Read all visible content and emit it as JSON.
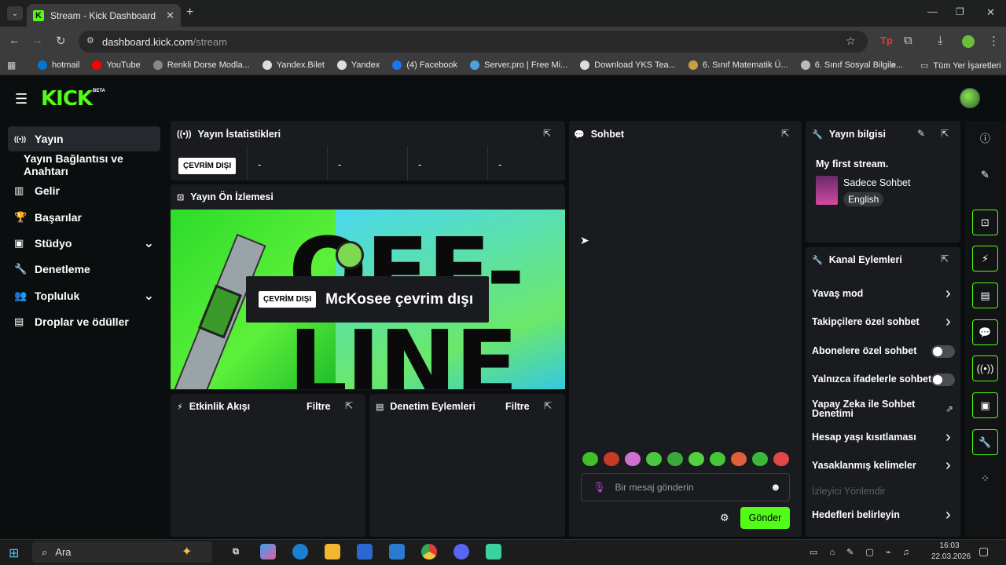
{
  "browser": {
    "tab_title": "Stream - Kick Dashboard",
    "url_host": "dashboard.kick.com",
    "url_path": "/stream",
    "bookmarks": [
      {
        "label": "hotmail",
        "color": "#0078d4"
      },
      {
        "label": "YouTube",
        "color": "#ff0000"
      },
      {
        "label": "Renkli Dorse Modla...",
        "color": "#888888"
      },
      {
        "label": "Yandex.Bilet",
        "color": "#dddddd"
      },
      {
        "label": "Yandex",
        "color": "#dddddd"
      },
      {
        "label": "(4) Facebook",
        "color": "#1877f2"
      },
      {
        "label": "Server.pro | Free Mi...",
        "color": "#4aa3df"
      },
      {
        "label": "Download YKS Tea...",
        "color": "#dddddd"
      },
      {
        "label": "6. Sınıf Matematik Ü...",
        "color": "#c8a040"
      },
      {
        "label": "6. Sınıf Sosyal Bilgile...",
        "color": "#bbbbbb"
      }
    ],
    "bookmarks_all": "Tüm Yer İşaretleri"
  },
  "header": {
    "logo": "KICK",
    "beta": "BETA"
  },
  "sidebar": {
    "items": [
      {
        "label": "Yayın",
        "icon": "broadcast-icon",
        "active": true
      },
      {
        "label": "Yayın Bağlantısı ve Anahtarı",
        "icon": ""
      },
      {
        "label": "Gelir",
        "icon": "chart-icon"
      },
      {
        "label": "Başarılar",
        "icon": "trophy-icon"
      },
      {
        "label": "Stüdyo",
        "icon": "studio-icon"
      },
      {
        "label": "Denetleme",
        "icon": "wrench-icon"
      },
      {
        "label": "Topluluk",
        "icon": "people-icon"
      },
      {
        "label": "Droplar ve ödüller",
        "icon": "gift-icon"
      }
    ]
  },
  "stats": {
    "title": "Yayın İstatistikleri",
    "status": "ÇEVRİM DIŞI",
    "values": [
      "-",
      "-",
      "-",
      "-"
    ]
  },
  "preview": {
    "title": "Yayın Ön İzlemesi",
    "status": "ÇEVRİM DIŞI",
    "message": "McKosee çevrim dışı",
    "art_text": "OFF-LINE"
  },
  "activity": {
    "title": "Etkinlik Akışı",
    "filter": "Filtre"
  },
  "moderation": {
    "title": "Denetim Eylemleri",
    "filter": "Filtre"
  },
  "chat": {
    "title": "Sohbet",
    "placeholder": "Bir mesaj gönderin",
    "send": "Gönder"
  },
  "stream_info": {
    "title": "Yayın bilgisi",
    "stream_title": "My first stream.",
    "category": "Sadece Sohbet",
    "language": "English"
  },
  "channel_actions": {
    "title": "Kanal Eylemleri",
    "items": [
      {
        "label": "Yavaş mod",
        "kind": "chevron"
      },
      {
        "label": "Takipçilere özel sohbet",
        "kind": "chevron"
      },
      {
        "label": "Abonelere özel sohbet",
        "kind": "toggle"
      },
      {
        "label": "Yalnızca ifadelerle sohbet",
        "kind": "toggle"
      },
      {
        "label": "Yapay Zeka ile Sohbet Denetimi",
        "kind": "external"
      },
      {
        "label": "Hesap yaşı kısıtlaması",
        "kind": "chevron"
      },
      {
        "label": "Yasaklanmış kelimeler",
        "kind": "chevron"
      },
      {
        "label": "İzleyici Yönlendir",
        "kind": "disabled"
      },
      {
        "label": "Hedefleri belirleyin",
        "kind": "chevron"
      }
    ]
  },
  "taskbar": {
    "search": "Ara",
    "time": "16:03",
    "date": "22.03.2026"
  },
  "colors": {
    "accent": "#53fc18",
    "panel": "#191b1f",
    "background": "#0b0e0f"
  }
}
